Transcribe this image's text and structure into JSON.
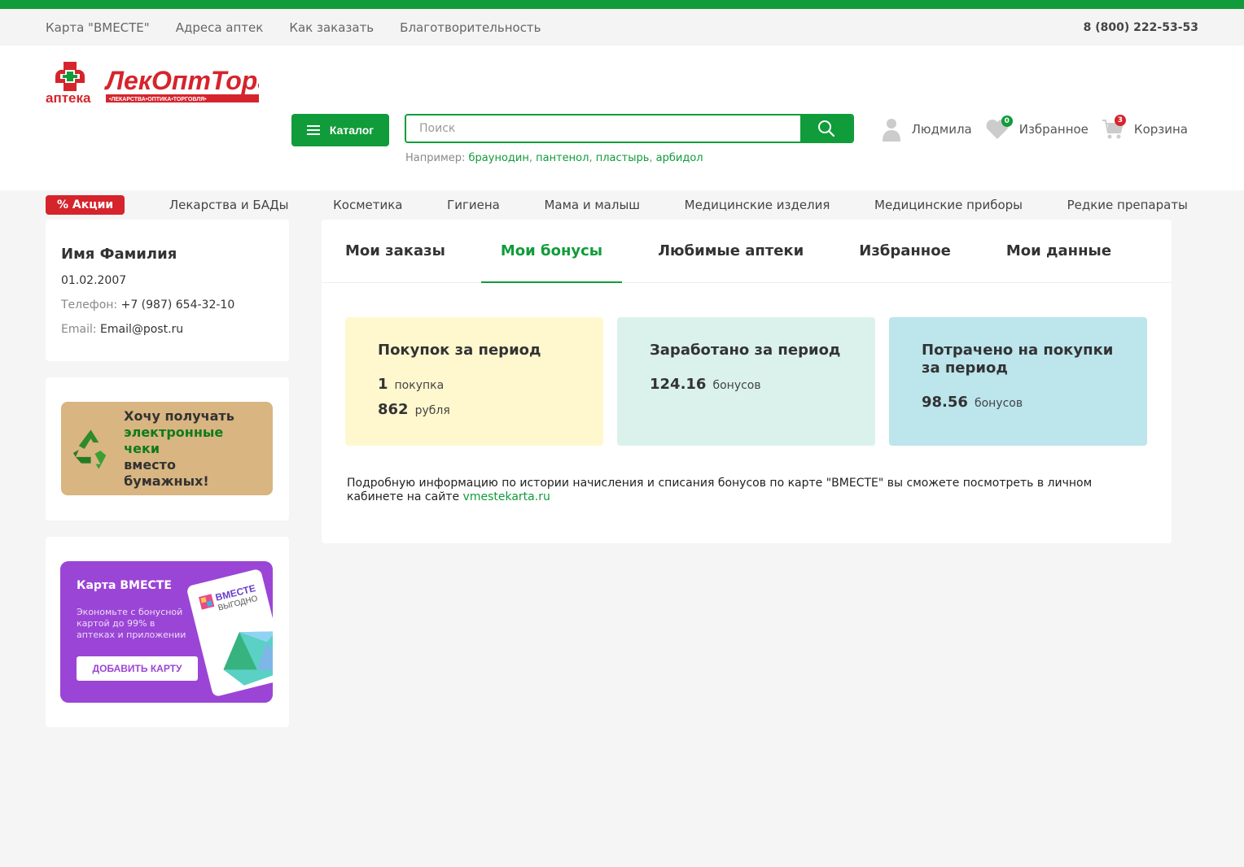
{
  "topbar": {
    "links": [
      "Карта \"ВМЕСТЕ\"",
      "Адреса аптек",
      "Как заказать",
      "Благотворительность"
    ],
    "phone": "8 (800) 222-53-53"
  },
  "header": {
    "logo_alt": "аптека ЛекОптТорг",
    "catalog_label": "Каталог",
    "search_placeholder": "Поиск",
    "examples_label": "Например:",
    "examples": [
      "браунодин",
      "пантенол",
      "пластырь",
      "арбидол"
    ],
    "user_name": "Людмила",
    "favorites_label": "Избранное",
    "favorites_count": "0",
    "cart_label": "Корзина",
    "cart_count": "3"
  },
  "nav": {
    "promo": "% Акции",
    "items": [
      "Лекарства и БАДы",
      "Косметика",
      "Гигиена",
      "Мама и малыш",
      "Медицинские изделия",
      "Медицинские приборы",
      "Редкие препараты"
    ]
  },
  "profile": {
    "name": "Имя Фамилия",
    "birthdate": "01.02.2007",
    "phone_label": "Телефон:",
    "phone": "+7 (987) 654-32-10",
    "email_label": "Email:",
    "email": "Email@post.ru"
  },
  "eco_banner": {
    "line1": "Хочу получать",
    "line2": "электронные чеки",
    "line3": "вместо бумажных!"
  },
  "vmeste_banner": {
    "title": "Карта ВМЕСТЕ",
    "desc": "Экономьте с бонусной картой до 99% в аптеках и приложении",
    "button": "ДОБАВИТЬ КАРТУ",
    "card_text1": "ВМЕСТЕ",
    "card_text2": "ВЫГОДНО"
  },
  "tabs": [
    {
      "label": "Мои заказы",
      "active": false
    },
    {
      "label": "Мои бонусы",
      "active": true
    },
    {
      "label": "Любимые аптеки",
      "active": false
    },
    {
      "label": "Избранное",
      "active": false
    },
    {
      "label": "Мои данные",
      "active": false
    }
  ],
  "tiles": {
    "purchases": {
      "title": "Покупок за период",
      "count": "1",
      "count_unit": "покупка",
      "sum": "862",
      "sum_unit": "рубля"
    },
    "earned": {
      "title": "Заработано за период",
      "value": "124.16",
      "unit": "бонусов"
    },
    "spent": {
      "title": "Потрачено на покупки за период",
      "value": "98.56",
      "unit": "бонусов"
    }
  },
  "info": {
    "text": "Подробную информацию по истории начисления и списания бонусов по карте \"ВМЕСТЕ\" вы сможете посмотреть в личном кабинете на сайте",
    "link": "vmestekarta.ru"
  },
  "colors": {
    "brand_green": "#109c3a",
    "promo_red": "#d6242c",
    "vmeste_purple": "#9b45d6"
  }
}
